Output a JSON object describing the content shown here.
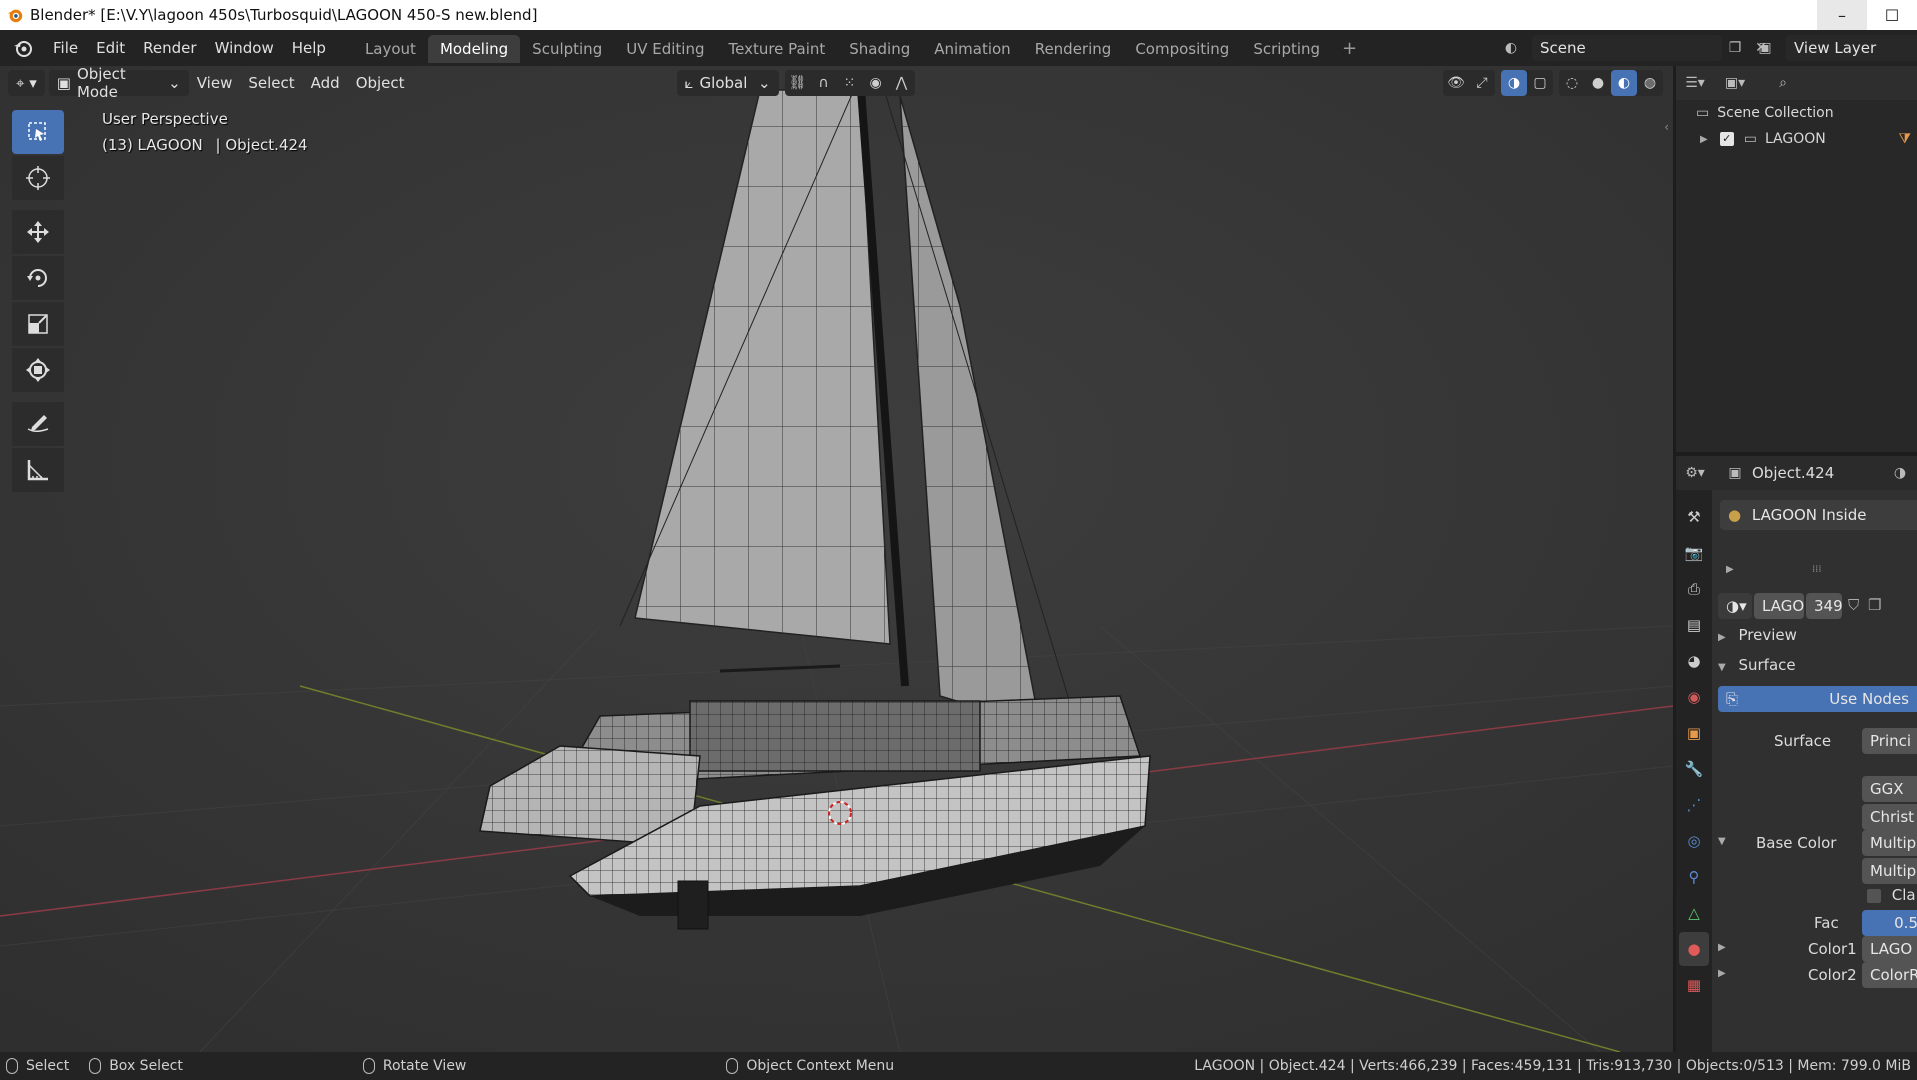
{
  "window": {
    "title": "Blender* [E:\\V.Y\\lagoon 450s\\Turbosquid\\LAGOON  450-S new.blend]",
    "minimize_label": "–",
    "maximize_label": "☐"
  },
  "menu": {
    "items": [
      "File",
      "Edit",
      "Render",
      "Window",
      "Help"
    ]
  },
  "workspaces": {
    "tabs": [
      "Layout",
      "Modeling",
      "Sculpting",
      "UV Editing",
      "Texture Paint",
      "Shading",
      "Animation",
      "Rendering",
      "Compositing",
      "Scripting"
    ],
    "active": "Modeling",
    "add_label": "+"
  },
  "scene": {
    "name": "Scene"
  },
  "view_layer": {
    "name": "View Layer"
  },
  "viewport_header": {
    "mode": "Object Mode",
    "menus": [
      "View",
      "Select",
      "Add",
      "Object"
    ],
    "orientation": "Global"
  },
  "viewport": {
    "perspective": "User Perspective",
    "object_info": "(13) LAGOON",
    "active_object": "| Object.424"
  },
  "outliner": {
    "root": "Scene Collection",
    "collection": "LAGOON"
  },
  "properties": {
    "object_name": "Object.424",
    "material_slot": "LAGOON  Inside",
    "material_name": "LAGO...",
    "material_users": "349",
    "panels": {
      "preview": "Preview",
      "surface": "Surface"
    },
    "use_nodes": "Use Nodes",
    "surface_label": "Surface",
    "surface_value": "Princi",
    "distribution": "GGX",
    "subsurface": "Christ",
    "base_color_label": "Base Color",
    "base_color_value": "Multip",
    "blend_type": "Multip",
    "clamp_label": "Cla",
    "fac_label": "Fac",
    "fac_value": "0.5",
    "color1_label": "Color1",
    "color1_value": "LAGO",
    "color2_label": "Color2",
    "color2_value": "ColorR"
  },
  "statusbar": {
    "select": "Select",
    "box_select": "Box Select",
    "rotate": "Rotate View",
    "context_menu": "Object Context Menu",
    "stats": "LAGOON   | Object.424 | Verts:466,239 | Faces:459,131 | Tris:913,730 | Objects:0/513 | Mem: 799.0 MiB"
  },
  "colors": {
    "accent": "#4772b3",
    "viewport_bg": "#393939",
    "header_bg": "#232323"
  },
  "icons": {
    "tools": [
      "select-box-icon",
      "cursor-icon",
      "move-icon",
      "rotate-icon",
      "scale-icon",
      "transform-icon",
      "annotate-icon",
      "measure-icon"
    ],
    "property_tabs": [
      "tool-icon",
      "render-icon",
      "output-icon",
      "view-layer-icon",
      "scene-icon",
      "world-icon",
      "object-icon",
      "modifier-icon",
      "particles-icon",
      "physics-icon",
      "constraints-icon",
      "data-icon",
      "material-icon",
      "texture-icon"
    ]
  }
}
